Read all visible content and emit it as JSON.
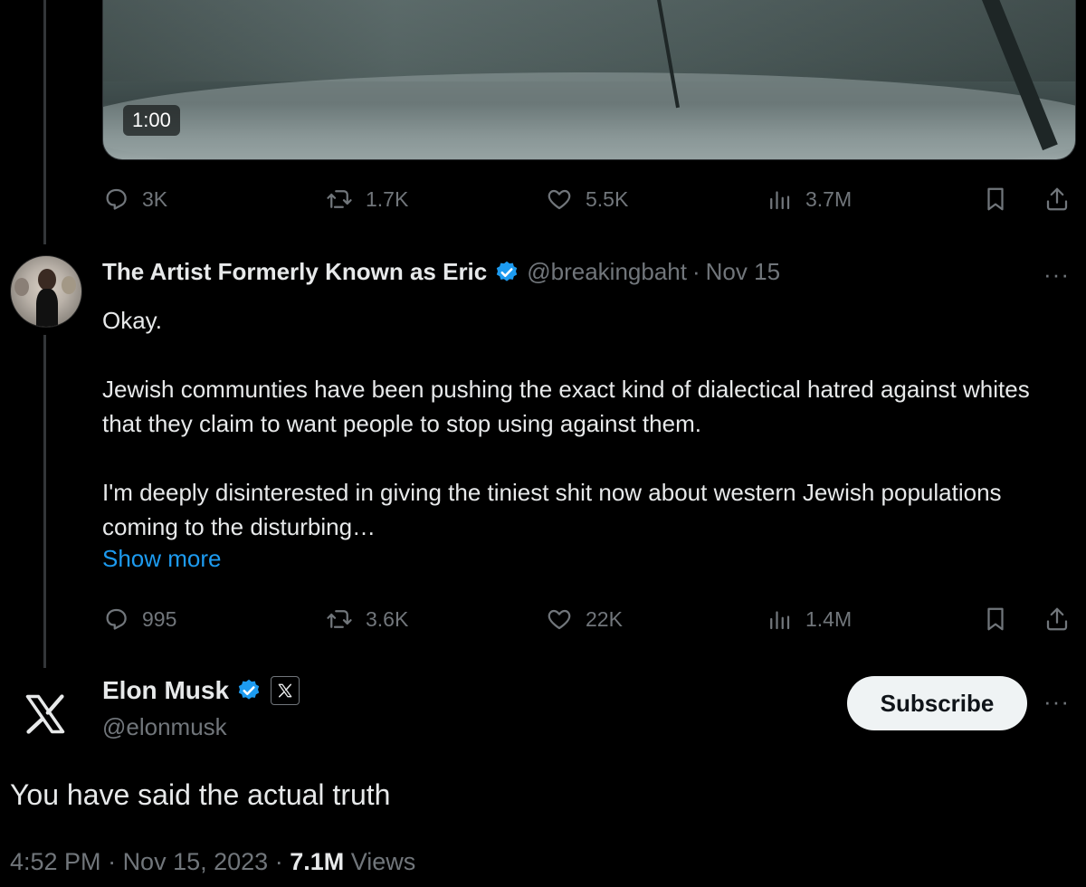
{
  "video": {
    "duration": "1:00"
  },
  "first_tweet_actions": {
    "replies": "3K",
    "reposts": "1.7K",
    "likes": "5.5K",
    "views": "3.7M"
  },
  "reply_tweet": {
    "author_name": "The Artist Formerly Known as Eric",
    "handle": "@breakingbaht",
    "separator": "·",
    "date": "Nov 15",
    "more": "···",
    "text_paragraphs": [
      "Okay.",
      "Jewish communties have been pushing the exact kind of dialectical hatred against whites that they claim to want people to stop using against them.",
      "I'm deeply disinterested in giving the tiniest shit now about western Jewish populations coming to the disturbing…"
    ],
    "show_more": "Show more",
    "actions": {
      "replies": "995",
      "reposts": "3.6K",
      "likes": "22K",
      "views": "1.4M"
    }
  },
  "main_tweet": {
    "author_name": "Elon Musk",
    "handle": "@elonmusk",
    "subscribe_label": "Subscribe",
    "more": "···",
    "text": "You have said the actual truth",
    "time": "4:52 PM",
    "dot1": " · ",
    "date": "Nov 15, 2023",
    "dot2": " · ",
    "views_count": "7.1M",
    "views_label": " Views"
  },
  "colors": {
    "background": "#000000",
    "text": "#e7e9ea",
    "muted": "#71767b",
    "link": "#1d9bf0",
    "verified": "#1d9bf0",
    "button_bg": "#eff3f4"
  }
}
